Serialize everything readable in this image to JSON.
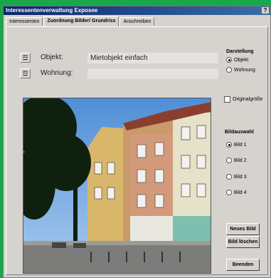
{
  "window": {
    "title": "Interessentenverwaltung Exposee",
    "help": "?"
  },
  "tabs": [
    {
      "label": "Interessenten"
    },
    {
      "label": "Zuordnung Bilder/ Grundriss"
    },
    {
      "label": "Anschreiben"
    }
  ],
  "fields": {
    "objekt_label": "Objekt:",
    "objekt_value": "Mietobjekt einfach",
    "wohnung_label": "Wohnung:",
    "wohnung_value": ""
  },
  "darstellung": {
    "title": "Darstellung",
    "options": [
      {
        "label": "Objekt"
      },
      {
        "label": "Wohnung"
      }
    ],
    "selected": "Objekt"
  },
  "originalgroesse": {
    "label": "Originalgröße"
  },
  "bildauswahl": {
    "title": "Bildauswahl",
    "options": [
      {
        "label": "Bild 1"
      },
      {
        "label": "Bild 2"
      },
      {
        "label": "Bild 3"
      },
      {
        "label": "Bild 4"
      }
    ],
    "selected": "Bild 1"
  },
  "buttons": {
    "neues_bild": "Neues Bild",
    "bild_loeschen": "Bild löschen",
    "beenden": "Beenden"
  },
  "icons": {
    "search": "binoculars-icon"
  }
}
